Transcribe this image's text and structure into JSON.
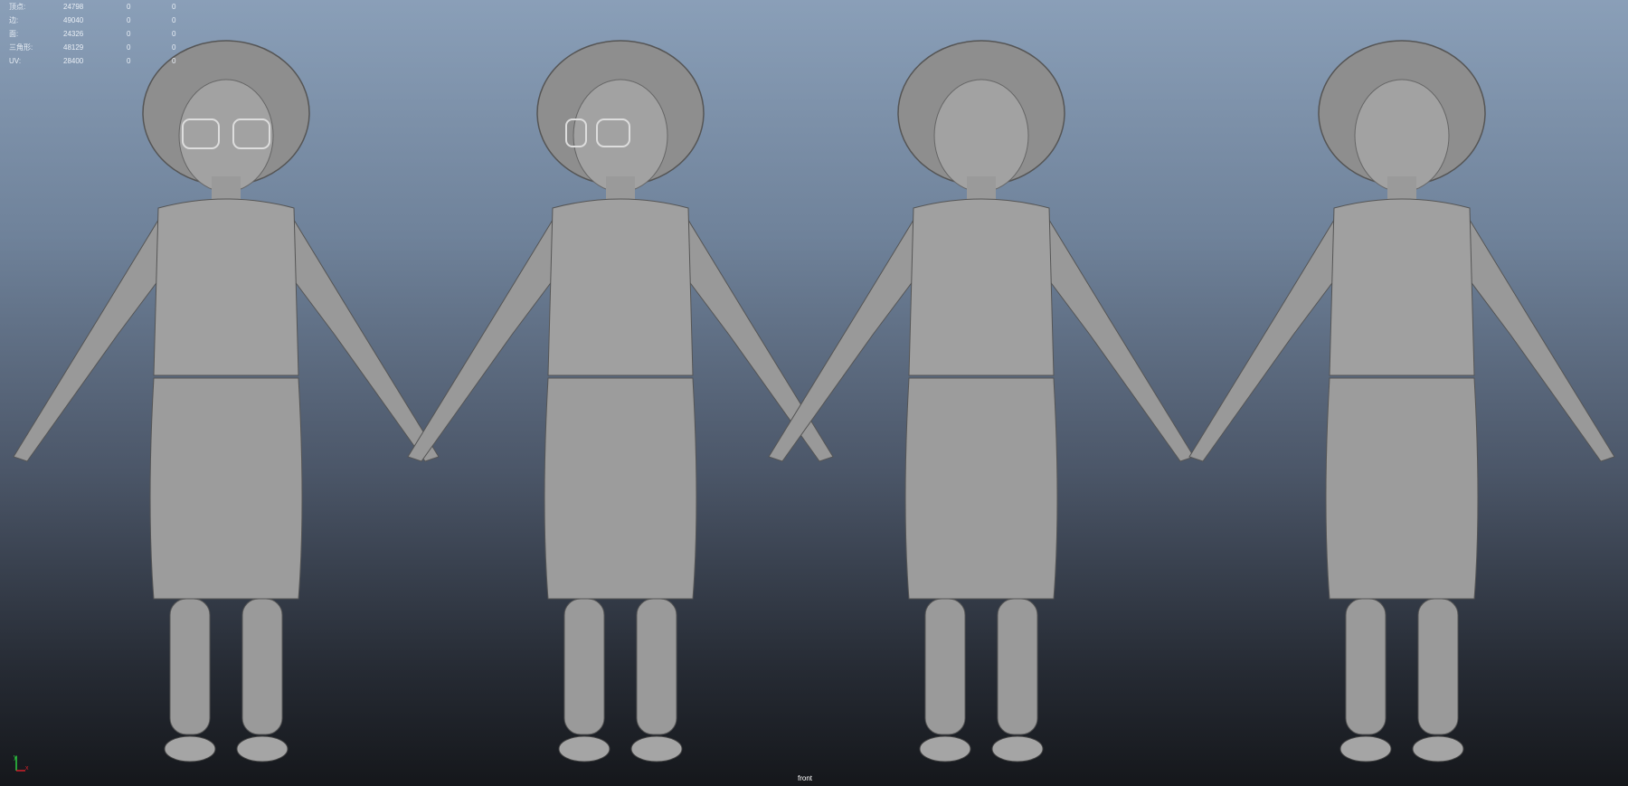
{
  "hud": {
    "rows": [
      {
        "label": "顶点:",
        "v1": "24798",
        "v2": "0",
        "v3": "0"
      },
      {
        "label": "边:",
        "v1": "49040",
        "v2": "0",
        "v3": "0"
      },
      {
        "label": "面:",
        "v1": "24326",
        "v2": "0",
        "v3": "0"
      },
      {
        "label": "三角形:",
        "v1": "48129",
        "v2": "0",
        "v3": "0"
      },
      {
        "label": "UV:",
        "v1": "28400",
        "v2": "0",
        "v3": "0"
      }
    ]
  },
  "camera_name": "front",
  "axis": {
    "y": "y",
    "x": "x"
  },
  "colors": {
    "model": "#9a9a9a",
    "axis_y": "#2ecc40",
    "axis_x": "#d0202a"
  }
}
